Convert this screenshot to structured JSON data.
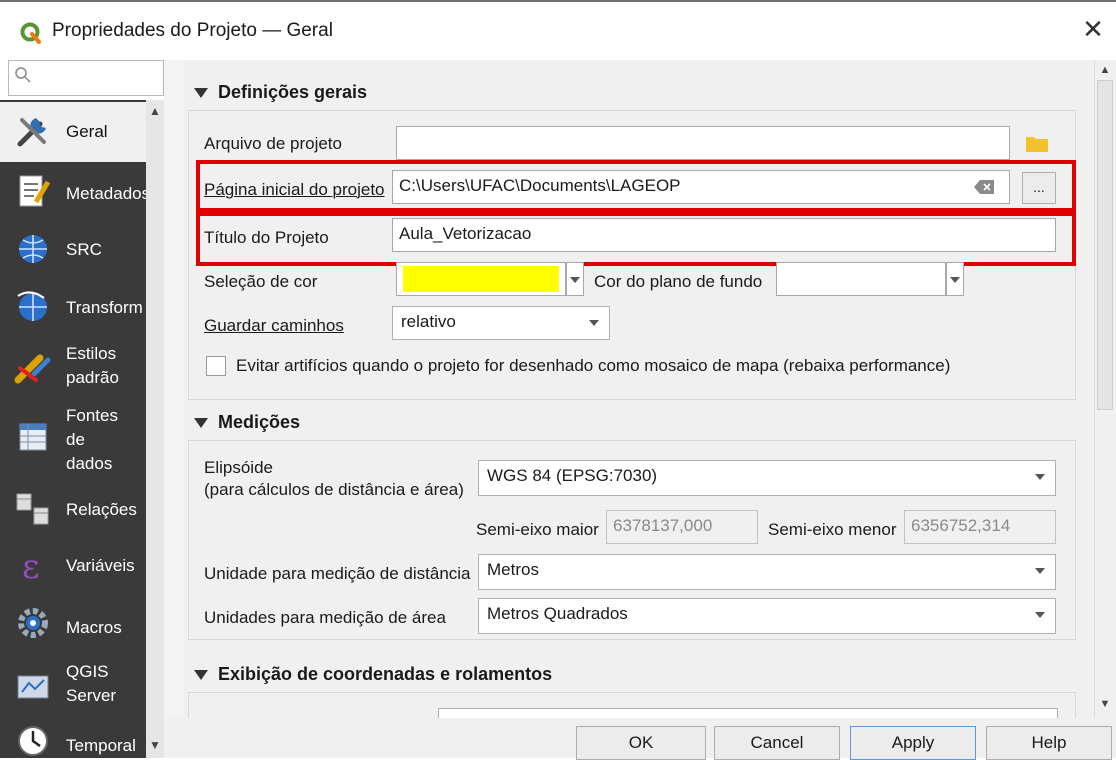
{
  "window": {
    "title": "Propriedades do Projeto — Geral",
    "close_label": "✕"
  },
  "search": {
    "placeholder": ""
  },
  "sidebar": {
    "items": [
      {
        "label": "Geral",
        "icon": "tools-icon"
      },
      {
        "label": "Metadados",
        "icon": "metadata-icon"
      },
      {
        "label": "SRC",
        "icon": "globe-icon"
      },
      {
        "label": "Transform",
        "icon": "globe-transform-icon"
      },
      {
        "label": "Estilos\npadrão",
        "icon": "styles-brush-icon"
      },
      {
        "label": "Fontes\nde\ndados",
        "icon": "table-icon"
      },
      {
        "label": "Relações",
        "icon": "relations-icon"
      },
      {
        "label": "Variáveis",
        "icon": "variables-epsilon-icon"
      },
      {
        "label": "Macros",
        "icon": "macros-gear-icon"
      },
      {
        "label": "QGIS\nServer",
        "icon": "server-icon"
      },
      {
        "label": "Temporal",
        "icon": "clock-icon"
      }
    ]
  },
  "general": {
    "header": "Definições gerais",
    "project_file_label": "Arquivo de projeto",
    "project_file_value": "",
    "home_label": "Página inicial do projeto",
    "home_value": "C:\\Users\\UFAC\\Documents\\LAGEOP",
    "home_browse": "...",
    "title_label": "Título do Projeto",
    "title_value": "Aula_Vetorizacao",
    "selection_color_label": "Seleção de cor",
    "selection_color": "#ffff00",
    "background_color_label": "Cor do plano de fundo",
    "save_paths_label": "Guardar caminhos",
    "save_paths_value": "relativo",
    "avoid_artifacts_label": "Evitar artifícios quando o projeto for desenhado como mosaico de mapa (rebaixa performance)"
  },
  "measurements": {
    "header": "Medições",
    "ellipsoid_label_1": "Elipsóide",
    "ellipsoid_label_2": "(para cálculos de distância e área)",
    "ellipsoid_value": "WGS 84 (EPSG:7030)",
    "semi_major_label": "Semi-eixo maior",
    "semi_major_value": "6378137,000",
    "semi_minor_label": "Semi-eixo menor",
    "semi_minor_value": "6356752,314",
    "distance_unit_label": "Unidade para medição de distância",
    "distance_unit_value": "Metros",
    "area_unit_label": "Unidades para medição de área",
    "area_unit_value": "Metros Quadrados"
  },
  "coords": {
    "header": "Exibição de coordenadas e rolamentos"
  },
  "buttons": {
    "ok": "OK",
    "cancel": "Cancel",
    "apply": "Apply",
    "help": "Help"
  },
  "colors": {
    "highlight_red": "#e00000",
    "sidebar_bg": "#3a3a3a",
    "qgis_green": "#589632"
  }
}
